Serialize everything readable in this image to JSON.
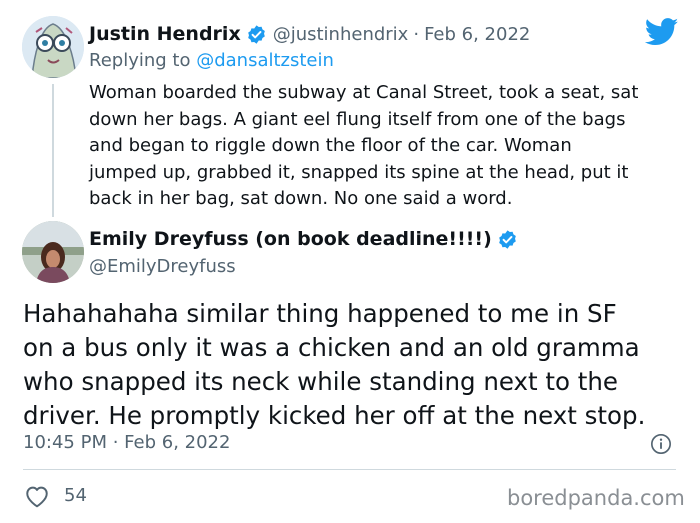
{
  "tweet_1": {
    "author_name": "Justin Hendrix",
    "author_handle": "@justinhendrix",
    "separator": "·",
    "date": "Feb 6, 2022",
    "replying_label": "Replying to ",
    "replying_to": "@dansaltzstein",
    "text": "Woman boarded the subway at Canal Street, took a seat, sat\ndown her bags. A giant eel flung itself from one of the bags\nand began to riggle down the floor of the car. Woman\njumped up, grabbed it, snapped its spine at the head, put it\nback in her bag, sat down. No one said a word."
  },
  "tweet_2": {
    "author_name": "Emily Dreyfuss (on book deadline!!!!)",
    "author_handle": "@EmilyDreyfuss",
    "text": "Hahahahaha similar thing happened to me in SF\non a bus only it was a chicken and an old gramma\nwho snapped its neck while standing next to the\ndriver. He promptly kicked her off at the next stop.",
    "timestamp": "10:45 PM · Feb 6, 2022",
    "like_count": "54"
  },
  "watermark": "boredpanda.com",
  "colors": {
    "twitter_blue": "#1d9bf0",
    "secondary_text": "#536471",
    "primary_text": "#0f1419",
    "divider": "#cfd9de"
  },
  "icons": [
    "verified-badge-icon",
    "twitter-bird-icon",
    "info-icon",
    "heart-icon"
  ]
}
